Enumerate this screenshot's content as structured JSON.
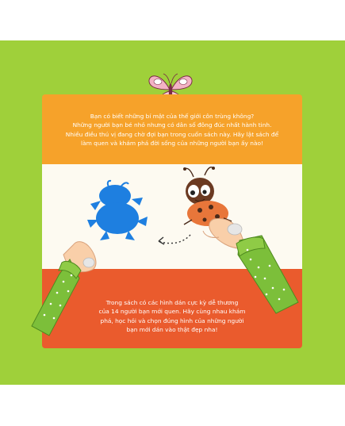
{
  "intro_text": {
    "line1": "Bạn có biết những bí mật của thế giới côn trùng không?",
    "line2": "Những người bạn bé nhỏ nhưng có dân số đông đúc nhất hành tinh.",
    "line3": "Nhiều điều thú vị đang chờ đợi bạn trong cuốn sách này. Hãy lật sách để",
    "line4": "làm quen và khám phá đời sống của những người bạn ấy nào!"
  },
  "outro_text": {
    "line1": "Trong sách có các hình dán cực kỳ dễ thương",
    "line2": "của 14 người bạn mới quen. Hãy cùng nhau khám",
    "line3": "phá, học hỏi và chọn đúng hình của những người",
    "line4": "bạn mới dán vào thật đẹp nha!"
  },
  "colors": {
    "background": "#9fd03a",
    "orange_band": "#f6a22a",
    "white_band": "#fdfaf1",
    "red_band": "#ea5b2d",
    "silhouette": "#1e7fe0",
    "ladybug": "#e8763a",
    "sleeve": "#7cbf3a"
  },
  "icons": [
    "butterfly-icon",
    "beetle-silhouette",
    "ladybug-sticker",
    "dotted-arrow-icon"
  ]
}
